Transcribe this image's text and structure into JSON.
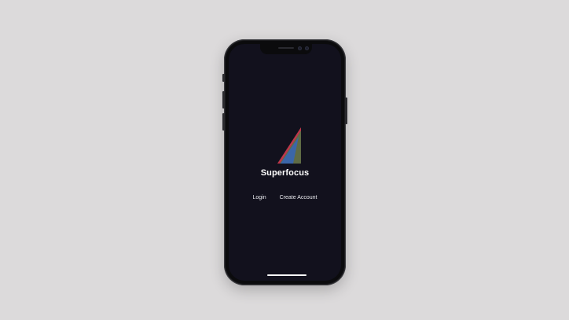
{
  "app": {
    "name": "Superfocus"
  },
  "actions": {
    "login_label": "Login",
    "create_account_label": "Create Account"
  },
  "colors": {
    "background": "#dcdadb",
    "screen": "#12111d",
    "logo_green": "#5f6b45",
    "logo_blue": "#3b66a8",
    "logo_red": "#c0344a",
    "text": "#ffffff"
  },
  "icons": {
    "logo": "triangle-sail-logo-icon"
  }
}
